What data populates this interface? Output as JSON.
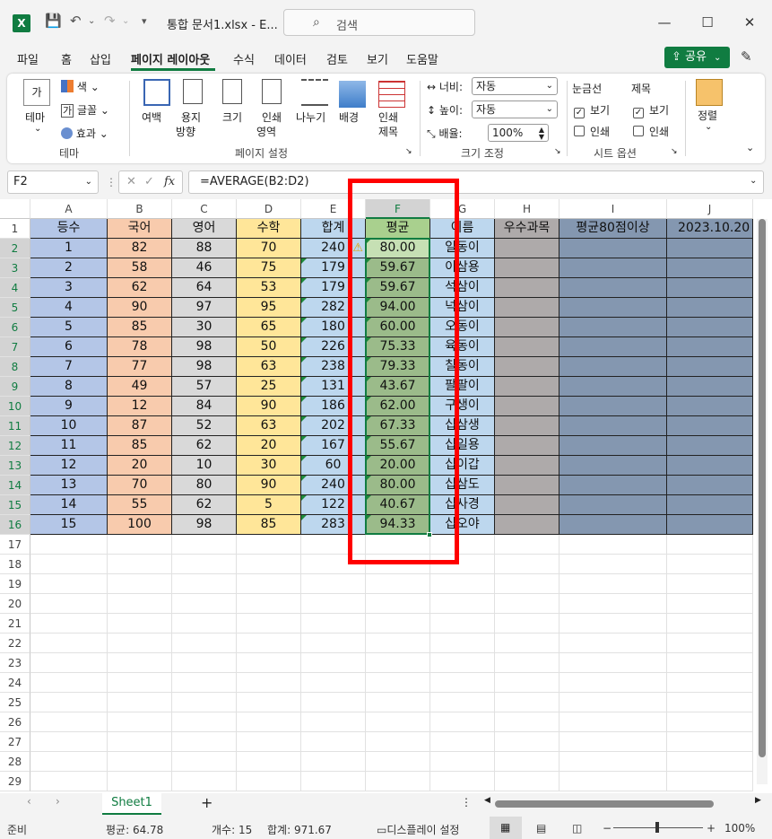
{
  "app": {
    "title": "통합 문서1.xlsx  -  E...",
    "search_placeholder": "검색"
  },
  "window": {
    "minimize": "—",
    "maximize": "☐",
    "close": "✕"
  },
  "tabs": [
    "파일",
    "홈",
    "삽입",
    "페이지 레이아웃",
    "수식",
    "데이터",
    "검토",
    "보기",
    "도움말"
  ],
  "active_tab": "페이지 레이아웃",
  "share_label": "공유",
  "ribbon": {
    "theme": {
      "big": "테마",
      "colors": "색",
      "fonts": "글꼴",
      "effects": "효과",
      "group": "테마"
    },
    "page_setup": {
      "margins": "여백",
      "orientation": [
        "용지",
        "방향"
      ],
      "size": "크기",
      "print_area": [
        "인쇄",
        "영역"
      ],
      "breaks": "나누기",
      "background": "배경",
      "print_titles": [
        "인쇄",
        "제목"
      ],
      "group": "페이지 설정"
    },
    "scale": {
      "width_label": "너비:",
      "width_value": "자동",
      "height_label": "높이:",
      "height_value": "자동",
      "scale_label": "배율:",
      "scale_value": "100%",
      "group": "크기 조정"
    },
    "sheet_options": {
      "gridlines": "눈금선",
      "headings": "제목",
      "view": "보기",
      "print": "인쇄",
      "group": "시트 옵션"
    },
    "arrange": {
      "label": "정렬"
    }
  },
  "formula_bar": {
    "name_box": "F2",
    "formula": "=AVERAGE(B2:D2)"
  },
  "columns": [
    "A",
    "B",
    "C",
    "D",
    "E",
    "F",
    "G",
    "H",
    "I",
    "J"
  ],
  "header_row": [
    "등수",
    "국어",
    "영어",
    "수학",
    "합계",
    "평균",
    "이름",
    "우수과목",
    "평균80점이상",
    "2023.10.20 1"
  ],
  "rows": [
    [
      "1",
      "82",
      "88",
      "70",
      "240",
      "80.00",
      "일동이"
    ],
    [
      "2",
      "58",
      "46",
      "75",
      "179",
      "59.67",
      "이삼용"
    ],
    [
      "3",
      "62",
      "64",
      "53",
      "179",
      "59.67",
      "석삼이"
    ],
    [
      "4",
      "90",
      "97",
      "95",
      "282",
      "94.00",
      "넉삼이"
    ],
    [
      "5",
      "85",
      "30",
      "65",
      "180",
      "60.00",
      "오동이"
    ],
    [
      "6",
      "78",
      "98",
      "50",
      "226",
      "75.33",
      "육동이"
    ],
    [
      "7",
      "77",
      "98",
      "63",
      "238",
      "79.33",
      "칠동이"
    ],
    [
      "8",
      "49",
      "57",
      "25",
      "131",
      "43.67",
      "팔팔이"
    ],
    [
      "9",
      "12",
      "84",
      "90",
      "186",
      "62.00",
      "구생이"
    ],
    [
      "10",
      "87",
      "52",
      "63",
      "202",
      "67.33",
      "십삼생"
    ],
    [
      "11",
      "85",
      "62",
      "20",
      "167",
      "55.67",
      "십일용"
    ],
    [
      "12",
      "20",
      "10",
      "30",
      "60",
      "20.00",
      "십이갑"
    ],
    [
      "13",
      "70",
      "80",
      "90",
      "240",
      "80.00",
      "십삼도"
    ],
    [
      "14",
      "55",
      "62",
      "5",
      "122",
      "40.67",
      "십사경"
    ],
    [
      "15",
      "100",
      "98",
      "85",
      "283",
      "94.33",
      "십오야"
    ]
  ],
  "row_numbers": [
    "1",
    "2",
    "3",
    "4",
    "5",
    "6",
    "7",
    "8",
    "9",
    "10",
    "11",
    "12",
    "13",
    "14",
    "15",
    "16",
    "17",
    "18",
    "19",
    "20",
    "21",
    "22",
    "23",
    "24",
    "25",
    "26",
    "27",
    "28",
    "29"
  ],
  "colors": {
    "A": "#b4c6e7",
    "B": "#f8cbad",
    "C": "#d9d9d9",
    "D": "#ffe699",
    "E": "#bdd7ee",
    "F": "#a9d08e",
    "G": "#bdd7ee",
    "H": "#aeaaaa",
    "I": "#8497b0",
    "J": "#8497b0",
    "accent": "#107c41",
    "highlight": "#ff0000"
  },
  "sheet_tab": "Sheet1",
  "status": {
    "ready": "준비",
    "average": "평균: 64.78",
    "count": "개수: 15",
    "sum": "합계: 971.67",
    "display_settings": "디스플레이 설정",
    "zoom": "100%"
  }
}
